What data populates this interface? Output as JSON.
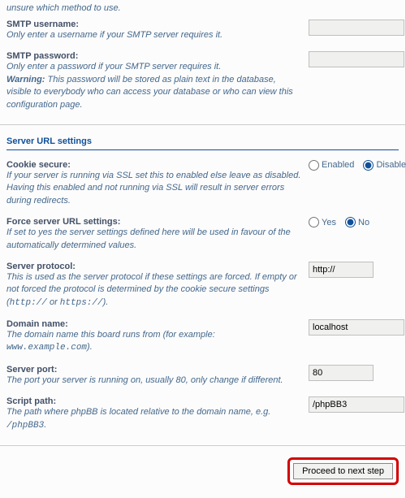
{
  "top_fragment": "unsure which method to use.",
  "smtp_user": {
    "label": "SMTP username:",
    "hint": "Only enter a username if your SMTP server requires it.",
    "value": ""
  },
  "smtp_pass": {
    "label": "SMTP password:",
    "hint_prefix": "Only enter a password if your SMTP server requires it.",
    "warn_label": "Warning:",
    "warn_text": " This password will be stored as plain text in the database, visible to everybody who can access your database or who can view this configuration page.",
    "value": ""
  },
  "section2_title": "Server URL settings",
  "cookie_secure": {
    "label": "Cookie secure:",
    "hint": "If your server is running via SSL set this to enabled else leave as disabled. Having this enabled and not running via SSL will result in server errors during redirects.",
    "opt_yes": "Enabled",
    "opt_no": "Disabled"
  },
  "force_url": {
    "label": "Force server URL settings:",
    "hint": "If set to yes the server settings defined here will be used in favour of the automatically determined values.",
    "opt_yes": "Yes",
    "opt_no": "No"
  },
  "server_protocol": {
    "label": "Server protocol:",
    "hint_a": "This is used as the server protocol if these settings are forced. If empty or not forced the protocol is determined by the cookie secure settings (",
    "code1": "http://",
    "mid": " or ",
    "code2": "https://",
    "hint_b": ").",
    "value": "http://"
  },
  "domain_name": {
    "label": "Domain name:",
    "hint_a": "The domain name this board runs from (for example: ",
    "code": "www.example.com",
    "hint_b": ").",
    "value": "localhost"
  },
  "server_port": {
    "label": "Server port:",
    "hint": "The port your server is running on, usually 80, only change if different.",
    "value": "80"
  },
  "script_path": {
    "label": "Script path:",
    "hint_a": "The path where phpBB is located relative to the domain name, e.g. ",
    "code": "/phpBB3",
    "hint_b": ".",
    "value": "/phpBB3"
  },
  "proceed": "Proceed to next step"
}
